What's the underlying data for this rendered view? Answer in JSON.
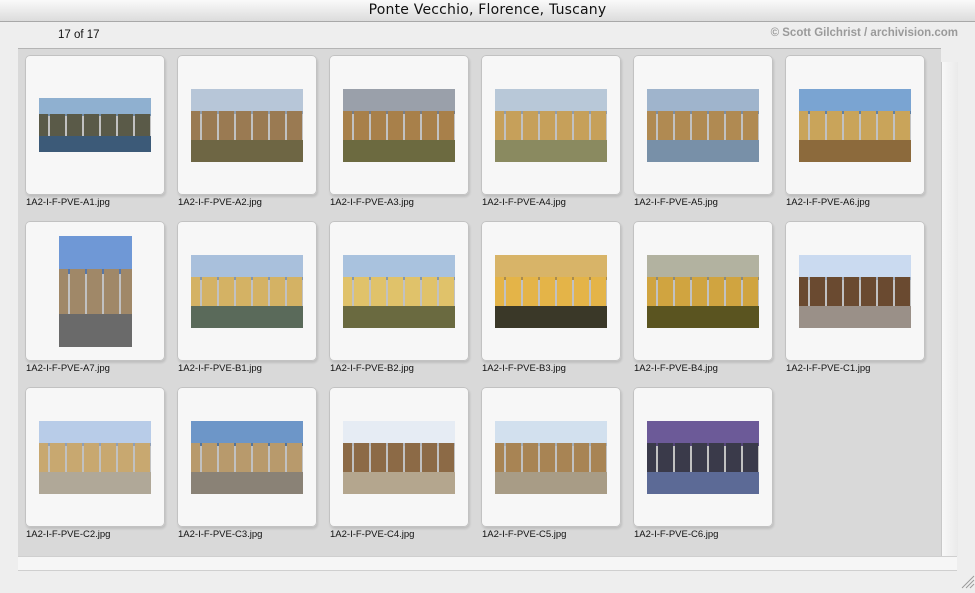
{
  "window": {
    "title": "Ponte Vecchio, Florence, Tuscany",
    "count_label": "17 of 17",
    "credit": "© Scott Gilchrist / archivision.com"
  },
  "icons": {
    "resize": "resize-grip-icon"
  },
  "thumbnails": [
    {
      "file": "1A2-I-F-PVE-A1.jpg",
      "orientation": "landscape",
      "palette": {
        "sky": "#8fb0d0",
        "building": "#5a5a48",
        "river": "#3c5a78"
      }
    },
    {
      "file": "1A2-I-F-PVE-A2.jpg",
      "orientation": "landscape",
      "palette": {
        "sky": "#b7c6d8",
        "building": "#9a7a52",
        "river": "#6e6644"
      }
    },
    {
      "file": "1A2-I-F-PVE-A3.jpg",
      "orientation": "landscape",
      "palette": {
        "sky": "#9aa0aa",
        "building": "#a8804a",
        "river": "#6c6a40"
      }
    },
    {
      "file": "1A2-I-F-PVE-A4.jpg",
      "orientation": "landscape",
      "palette": {
        "sky": "#b8c8d8",
        "building": "#c6a05a",
        "river": "#8a8a60"
      }
    },
    {
      "file": "1A2-I-F-PVE-A5.jpg",
      "orientation": "landscape",
      "palette": {
        "sky": "#9fb4cc",
        "building": "#b08a52",
        "river": "#7890a8"
      }
    },
    {
      "file": "1A2-I-F-PVE-A6.jpg",
      "orientation": "landscape",
      "palette": {
        "sky": "#7aa4d2",
        "building": "#c9a45a",
        "river": "#8c6a3c"
      }
    },
    {
      "file": "1A2-I-F-PVE-A7.jpg",
      "orientation": "portrait",
      "palette": {
        "sky": "#6f98d6",
        "building": "#a08868",
        "river": "#6a6a6a"
      }
    },
    {
      "file": "1A2-I-F-PVE-B1.jpg",
      "orientation": "landscape",
      "palette": {
        "sky": "#a9c0dc",
        "building": "#d4b264",
        "river": "#5a6a5a"
      }
    },
    {
      "file": "1A2-I-F-PVE-B2.jpg",
      "orientation": "landscape",
      "palette": {
        "sky": "#a9c2de",
        "building": "#e0c26a",
        "river": "#6a6a40"
      }
    },
    {
      "file": "1A2-I-F-PVE-B3.jpg",
      "orientation": "landscape",
      "palette": {
        "sky": "#d8b468",
        "building": "#e4b448",
        "river": "#3a3828"
      }
    },
    {
      "file": "1A2-I-F-PVE-B4.jpg",
      "orientation": "landscape",
      "palette": {
        "sky": "#b2b2a0",
        "building": "#d0a440",
        "river": "#5a5420"
      }
    },
    {
      "file": "1A2-I-F-PVE-C1.jpg",
      "orientation": "landscape",
      "palette": {
        "sky": "#cadaf0",
        "building": "#6a4a30",
        "river": "#9a9088"
      }
    },
    {
      "file": "1A2-I-F-PVE-C2.jpg",
      "orientation": "landscape",
      "palette": {
        "sky": "#b8cce8",
        "building": "#c8a870",
        "river": "#b0a898"
      }
    },
    {
      "file": "1A2-I-F-PVE-C3.jpg",
      "orientation": "landscape",
      "palette": {
        "sky": "#6d96c8",
        "building": "#b89a6c",
        "river": "#8a8276"
      }
    },
    {
      "file": "1A2-I-F-PVE-C4.jpg",
      "orientation": "landscape",
      "palette": {
        "sky": "#e6ecf4",
        "building": "#8c6a46",
        "river": "#b4a68e"
      }
    },
    {
      "file": "1A2-I-F-PVE-C5.jpg",
      "orientation": "landscape",
      "palette": {
        "sky": "#d2e0ee",
        "building": "#a88454",
        "river": "#a89c86"
      }
    },
    {
      "file": "1A2-I-F-PVE-C6.jpg",
      "orientation": "landscape",
      "palette": {
        "sky": "#6c5a98",
        "building": "#3a3a4a",
        "river": "#5c6a96"
      }
    }
  ]
}
